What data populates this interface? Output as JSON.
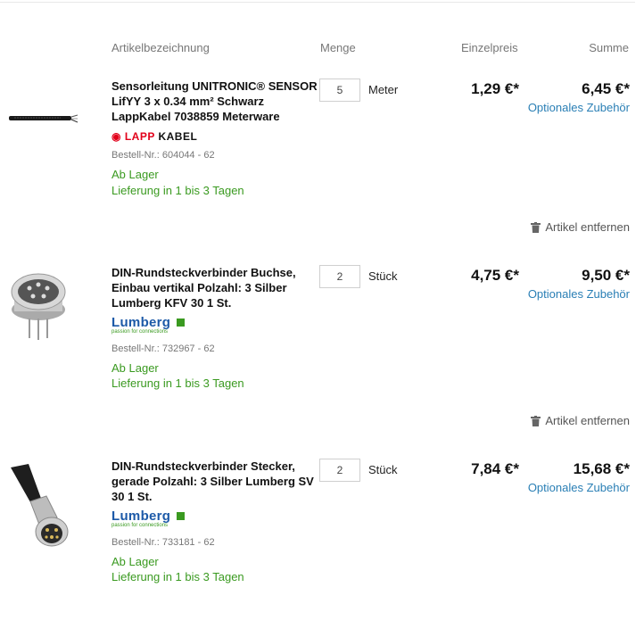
{
  "header": {
    "col_article": "Artikelbezeichnung",
    "col_qty": "Menge",
    "col_unit_price": "Einzelpreis",
    "col_total": "Summe"
  },
  "colors": {
    "link": "#2a7fb5",
    "stock": "#3a9a20",
    "lapp_red": "#e2001a",
    "lumberg_blue": "#1d5aa8"
  },
  "items": [
    {
      "title": "Sensorleitung UNITRONIC® SENSOR LifYY 3 x 0.34 mm² Schwarz LappKabel 7038859 Meterware",
      "qty": "5",
      "unit": "Meter",
      "unit_price": "1,29 €*",
      "total": "6,45 €*",
      "optional": "Optionales Zubehör",
      "brand_logo": "LAPP KABEL",
      "sku": "Bestell-Nr.: 604044 - 62",
      "stock": "Ab Lager",
      "delivery": "Lieferung in 1 bis 3 Tagen",
      "remove": "Artikel entfernen",
      "image": "black-cable"
    },
    {
      "title": "DIN-Rundsteckverbinder Buchse, Einbau vertikal Polzahl: 3 Silber Lumberg KFV 30 1 St.",
      "qty": "2",
      "unit": "Stück",
      "unit_price": "4,75 €*",
      "total": "9,50 €*",
      "optional": "Optionales Zubehör",
      "brand_logo": "Lumberg",
      "brand_tagline": "passion for connections",
      "sku": "Bestell-Nr.: 732967 - 62",
      "stock": "Ab Lager",
      "delivery": "Lieferung in 1 bis 3 Tagen",
      "remove": "Artikel entfernen",
      "image": "din-socket"
    },
    {
      "title": "DIN-Rundsteckverbinder Stecker, gerade Polzahl: 3 Silber Lumberg SV 30 1 St.",
      "qty": "2",
      "unit": "Stück",
      "unit_price": "7,84 €*",
      "total": "15,68 €*",
      "optional": "Optionales Zubehör",
      "brand_logo": "Lumberg",
      "brand_tagline": "passion for connections",
      "sku": "Bestell-Nr.: 733181 - 62",
      "stock": "Ab Lager",
      "delivery": "Lieferung in 1 bis 3 Tagen",
      "image": "din-plug"
    }
  ]
}
